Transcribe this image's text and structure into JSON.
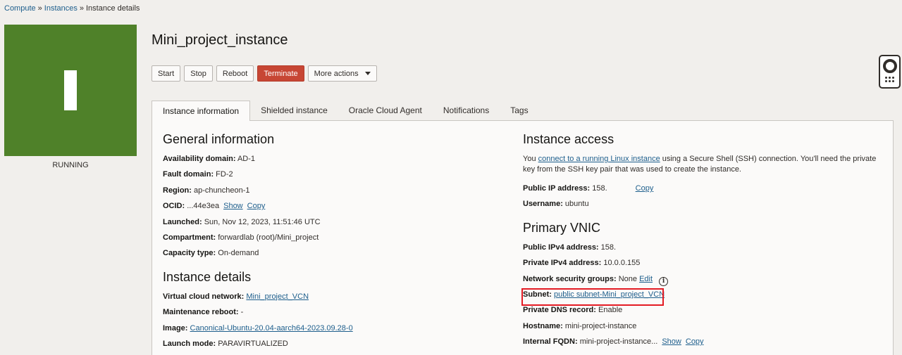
{
  "breadcrumb": {
    "compute": "Compute",
    "instances": "Instances",
    "current": "Instance details",
    "separator": "»"
  },
  "status": {
    "tile_letter": "I",
    "text": "RUNNING",
    "color": "#4f8129"
  },
  "title": "Mini_project_instance",
  "actions": {
    "start": "Start",
    "stop": "Stop",
    "reboot": "Reboot",
    "terminate": "Terminate",
    "more": "More actions"
  },
  "tabs": [
    {
      "label": "Instance information",
      "active": true
    },
    {
      "label": "Shielded instance",
      "active": false
    },
    {
      "label": "Oracle Cloud Agent",
      "active": false
    },
    {
      "label": "Notifications",
      "active": false
    },
    {
      "label": "Tags",
      "active": false
    }
  ],
  "general": {
    "heading": "General information",
    "availability_label": "Availability domain:",
    "availability_value": "AD-1",
    "fault_label": "Fault domain:",
    "fault_value": "FD-2",
    "region_label": "Region:",
    "region_value": "ap-chuncheon-1",
    "ocid_label": "OCID:",
    "ocid_value": "...44e3ea",
    "ocid_show": "Show",
    "ocid_copy": "Copy",
    "launched_label": "Launched:",
    "launched_value": "Sun, Nov 12, 2023, 11:51:46 UTC",
    "compartment_label": "Compartment:",
    "compartment_value": "forwardlab (root)/Mini_project",
    "capacity_label": "Capacity type:",
    "capacity_value": "On-demand"
  },
  "details": {
    "heading": "Instance details",
    "vcn_label": "Virtual cloud network:",
    "vcn_value": "Mini_project_VCN",
    "maint_label": "Maintenance reboot:",
    "maint_value": "-",
    "image_label": "Image:",
    "image_value": "Canonical-Ubuntu-20.04-aarch64-2023.09.28-0",
    "launch_mode_label": "Launch mode:",
    "launch_mode_value": "PARAVIRTUALIZED"
  },
  "access": {
    "heading": "Instance access",
    "para_prefix": "You ",
    "para_link": "connect to a running Linux instance",
    "para_suffix": " using a Secure Shell (SSH) connection. You'll need the private key from the SSH key pair that was used to create the instance.",
    "public_ip_label": "Public IP address:",
    "public_ip_value": "158.",
    "public_ip_copy": "Copy",
    "username_label": "Username:",
    "username_value": "ubuntu"
  },
  "vnic": {
    "heading": "Primary VNIC",
    "public_ipv4_label": "Public IPv4 address:",
    "public_ipv4_value": "158.",
    "private_ipv4_label": "Private IPv4 address:",
    "private_ipv4_value": "10.0.0.155",
    "nsg_label": "Network security groups:",
    "nsg_value": "None",
    "nsg_edit": "Edit",
    "info_glyph": "i",
    "subnet_label": "Subnet:",
    "subnet_value": "public subnet-Mini_project_VCN",
    "dns_label": "Private DNS record:",
    "dns_value": "Enable",
    "hostname_label": "Hostname:",
    "hostname_value": "mini-project-instance",
    "fqdn_label": "Internal FQDN:",
    "fqdn_value": "mini-project-instance...",
    "fqdn_show": "Show",
    "fqdn_copy": "Copy"
  },
  "help_widget": {
    "icon": "lifering-icon"
  }
}
